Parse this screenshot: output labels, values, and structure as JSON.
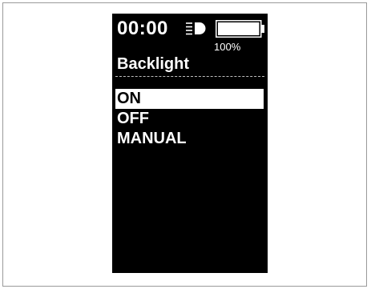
{
  "status_bar": {
    "time": "00:00",
    "light_icon": "light-beam-icon",
    "battery_icon": "battery-icon",
    "battery_percent": "100%",
    "battery_level": 1.0
  },
  "screen": {
    "title": "Backlight",
    "menu_items": [
      {
        "label": "ON",
        "selected": true
      },
      {
        "label": "OFF",
        "selected": false
      },
      {
        "label": "MANUAL",
        "selected": false
      }
    ]
  },
  "colors": {
    "screen_bg": "#000000",
    "text": "#ffffff",
    "highlight_bg": "#ffffff",
    "highlight_text": "#000000"
  }
}
